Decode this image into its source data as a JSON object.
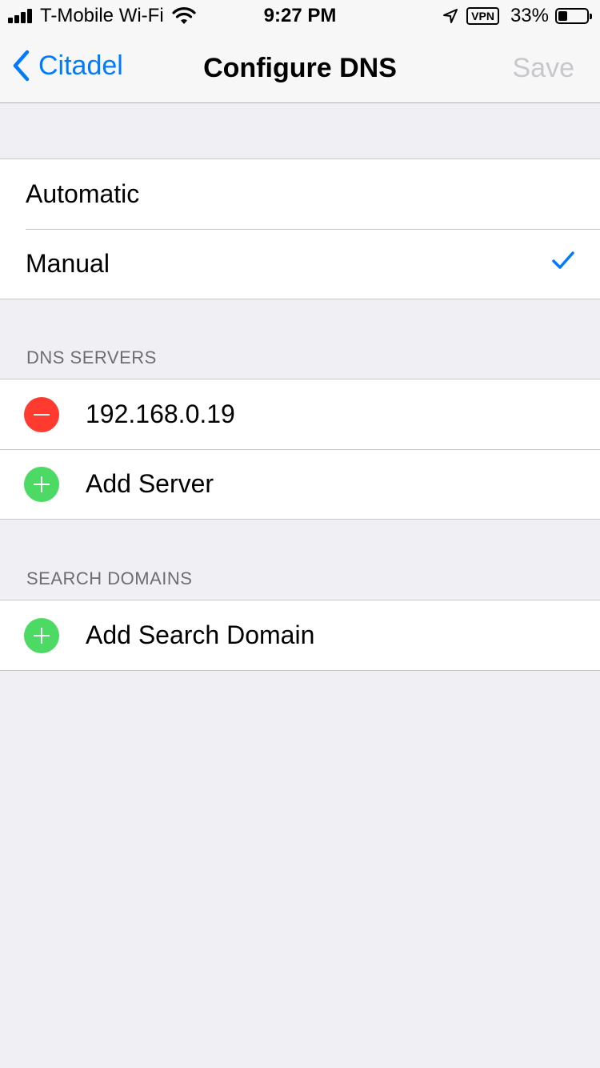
{
  "status_bar": {
    "carrier": "T-Mobile Wi-Fi",
    "time": "9:27 PM",
    "vpn": "VPN",
    "battery_percent": "33%",
    "battery_level": 0.33
  },
  "nav": {
    "back_label": "Citadel",
    "title": "Configure DNS",
    "save_label": "Save"
  },
  "mode": {
    "options": [
      "Automatic",
      "Manual"
    ],
    "selected": "Manual"
  },
  "dns_servers": {
    "header": "DNS SERVERS",
    "servers": [
      "192.168.0.19"
    ],
    "add_label": "Add Server"
  },
  "search_domains": {
    "header": "SEARCH DOMAINS",
    "add_label": "Add Search Domain"
  },
  "colors": {
    "accent": "#007aff",
    "delete": "#ff3b30",
    "add": "#4cd964",
    "disabled": "#c7c7cc"
  }
}
